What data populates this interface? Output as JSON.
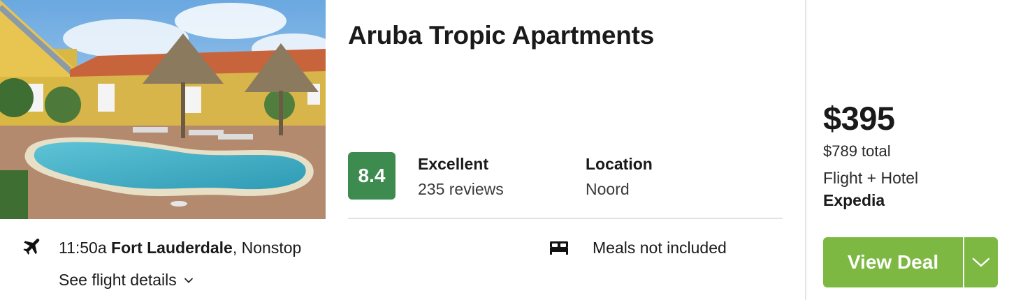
{
  "hotel": {
    "name": "Aruba Tropic Apartments",
    "score": "8.4",
    "rating_label": "Excellent",
    "review_count": "235 reviews",
    "location_label": "Location",
    "location_value": "Noord"
  },
  "flight": {
    "time": "11:50a",
    "airport": "Fort Lauderdale",
    "stops": ", Nonstop",
    "details_link": "See flight details"
  },
  "meals": "Meals not included",
  "pricing": {
    "price": "$395",
    "total": "$789 total",
    "deal_type": "Flight + Hotel",
    "provider": "Expedia",
    "button_label": "View Deal"
  },
  "icons": {
    "plane": "plane-icon",
    "bed": "bed-icon",
    "chevron": "chevron-down-icon"
  },
  "colors": {
    "score_badge": "#3d8b4f",
    "deal_button": "#7db842"
  }
}
